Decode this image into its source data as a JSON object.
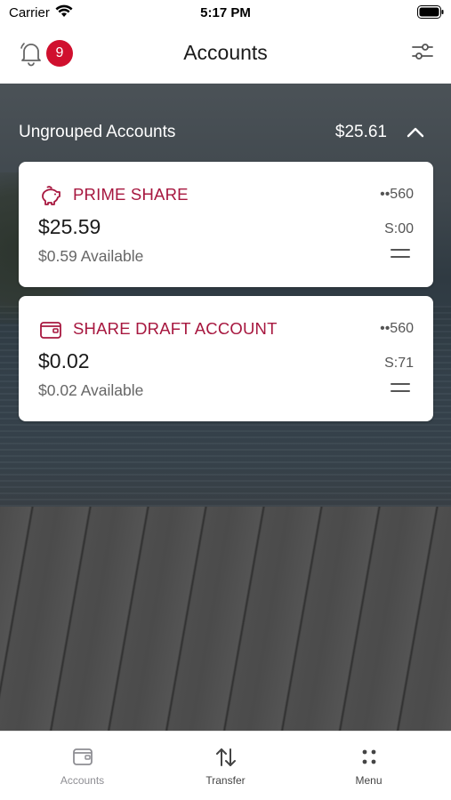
{
  "status_bar": {
    "carrier": "Carrier",
    "time": "5:17 PM"
  },
  "nav": {
    "title": "Accounts",
    "notification_count": "9"
  },
  "group": {
    "title": "Ungrouped Accounts",
    "total": "$25.61"
  },
  "accounts": [
    {
      "name": "PRIME SHARE",
      "mask": "••560",
      "balance": "$25.59",
      "code": "S:00",
      "available": "$0.59 Available",
      "icon": "piggy-bank-icon"
    },
    {
      "name": "SHARE DRAFT ACCOUNT",
      "mask": "••560",
      "balance": "$0.02",
      "code": "S:71",
      "available": "$0.02 Available",
      "icon": "wallet-icon"
    }
  ],
  "tabs": [
    {
      "label": "Accounts",
      "icon": "wallet-icon",
      "color": "#8e8e93"
    },
    {
      "label": "Transfer",
      "icon": "transfer-arrows-icon",
      "color": "#444444"
    },
    {
      "label": "Menu",
      "icon": "grid-dots-icon",
      "color": "#444444"
    }
  ],
  "colors": {
    "accent": "#a7173f",
    "badge": "#d0102e"
  }
}
